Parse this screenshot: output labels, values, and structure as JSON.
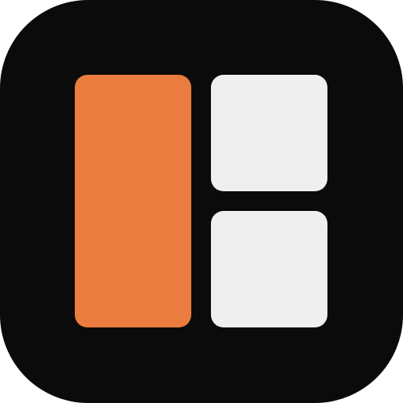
{
  "icon": {
    "semantic_name": "layout-panels-icon",
    "background_color": "#0b0b0b",
    "tiles": [
      {
        "name": "tile-left",
        "color": "#e97c3e"
      },
      {
        "name": "tile-top-right",
        "color": "#efefef"
      },
      {
        "name": "tile-bottom-right",
        "color": "#efefef"
      }
    ]
  }
}
